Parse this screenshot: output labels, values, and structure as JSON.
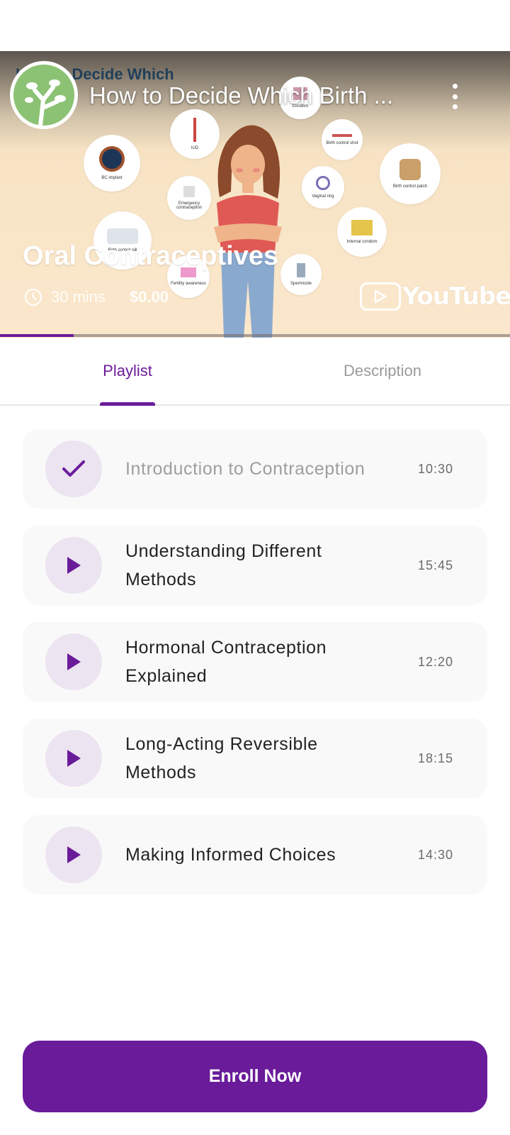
{
  "video": {
    "background_title": "How to Decide Which",
    "youtube_title": "How to Decide Which Birth ...",
    "brand": "YouTube",
    "progress_fraction": 0.145,
    "illustration_labels": [
      "BC implant",
      "IUD",
      "Emergency contraception",
      "Birth control pill",
      "Fertility awareness",
      "Condom",
      "Birth control shot",
      "Vaginal ring",
      "Birth control patch",
      "Internal condom",
      "Spermicide"
    ]
  },
  "course": {
    "title": "Oral Contraceptives",
    "duration": "30 mins",
    "price": "$0.00"
  },
  "tabs": [
    {
      "label": "Playlist",
      "active": true
    },
    {
      "label": "Description",
      "active": false
    }
  ],
  "playlist": [
    {
      "title": "Introduction to Contraception",
      "duration": "10:30",
      "status": "completed",
      "icon": "check-icon"
    },
    {
      "title": "Understanding Different Methods",
      "duration": "15:45",
      "status": "pending",
      "icon": "play-icon"
    },
    {
      "title": "Hormonal Contraception Explained",
      "duration": "12:20",
      "status": "pending",
      "icon": "play-icon"
    },
    {
      "title": "Long-Acting Reversible Methods",
      "duration": "18:15",
      "status": "pending",
      "icon": "play-icon"
    },
    {
      "title": "Making Informed Choices",
      "duration": "14:30",
      "status": "pending",
      "icon": "play-icon"
    }
  ],
  "actions": {
    "enroll_label": "Enroll Now"
  },
  "colors": {
    "accent": "#6a1b9a",
    "icon_bg": "#ece4f1",
    "card_bg": "#f9f9f9",
    "muted_text": "#9e9e9e"
  }
}
